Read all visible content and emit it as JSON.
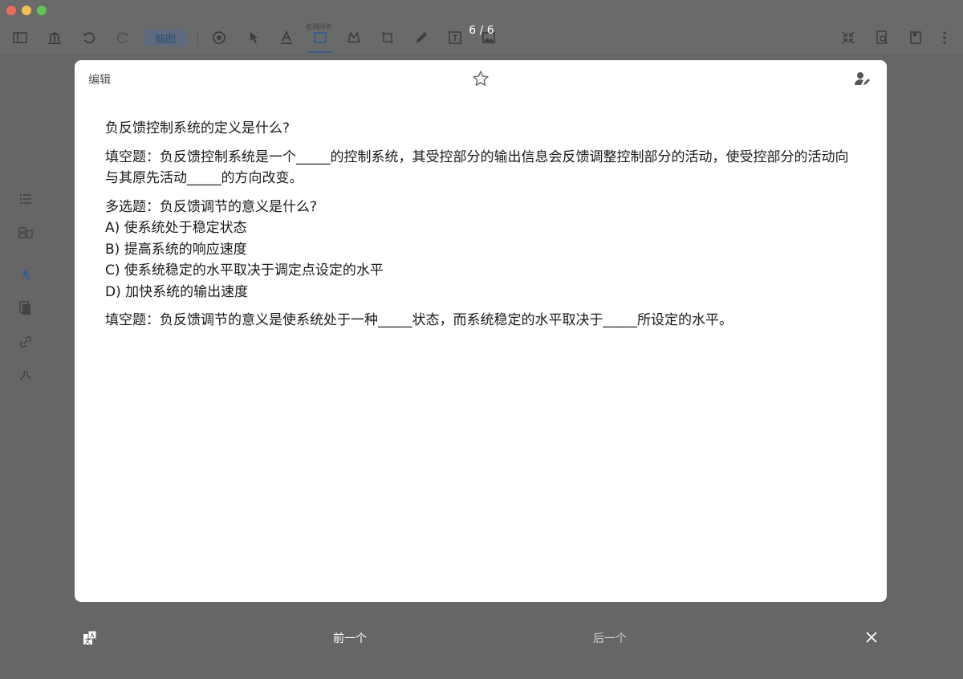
{
  "window": {
    "traffic_lights": [
      "close",
      "minimize",
      "zoom"
    ]
  },
  "toolbar": {
    "brain_button_label": "脑图",
    "rect_tool_label": "名词闪卡",
    "page_counter": "6 / 6",
    "icons": [
      "sidebar-icon",
      "library-icon",
      "undo-icon",
      "redo-icon",
      "target-icon",
      "pointer-icon",
      "highlight-icon",
      "rectangle-icon",
      "lasso-icon",
      "crop-icon",
      "pen-icon",
      "text-icon",
      "image-icon",
      "collapse-icon",
      "search-doc-icon",
      "bookmark-icon",
      "more-icon"
    ]
  },
  "sidebar": {
    "icons": [
      "list-icon",
      "outline-icon",
      "pointer-icon",
      "copy-icon",
      "link-icon",
      "squiggle-icon"
    ]
  },
  "card": {
    "edit_label": "编辑",
    "lines": [
      "负反馈控制系统的定义是什么?",
      "填空题：负反馈控制系统是一个_____的控制系统，其受控部分的输出信息会反馈调整控制部分的活动，使受控部分的活动向与其原先活动_____的方向改变。",
      "多选题：负反馈调节的意义是什么?",
      "A) 使系统处于稳定状态",
      "B) 提高系统的响应速度",
      "C) 使系统稳定的水平取决于调定点设定的水平",
      "D) 加快系统的输出速度",
      "填空题：负反馈调节的意义是使系统处于一种_____状态，而系统稳定的水平取决于_____所设定的水平。"
    ]
  },
  "bottom": {
    "prev_label": "前一个",
    "next_label": "后一个"
  }
}
